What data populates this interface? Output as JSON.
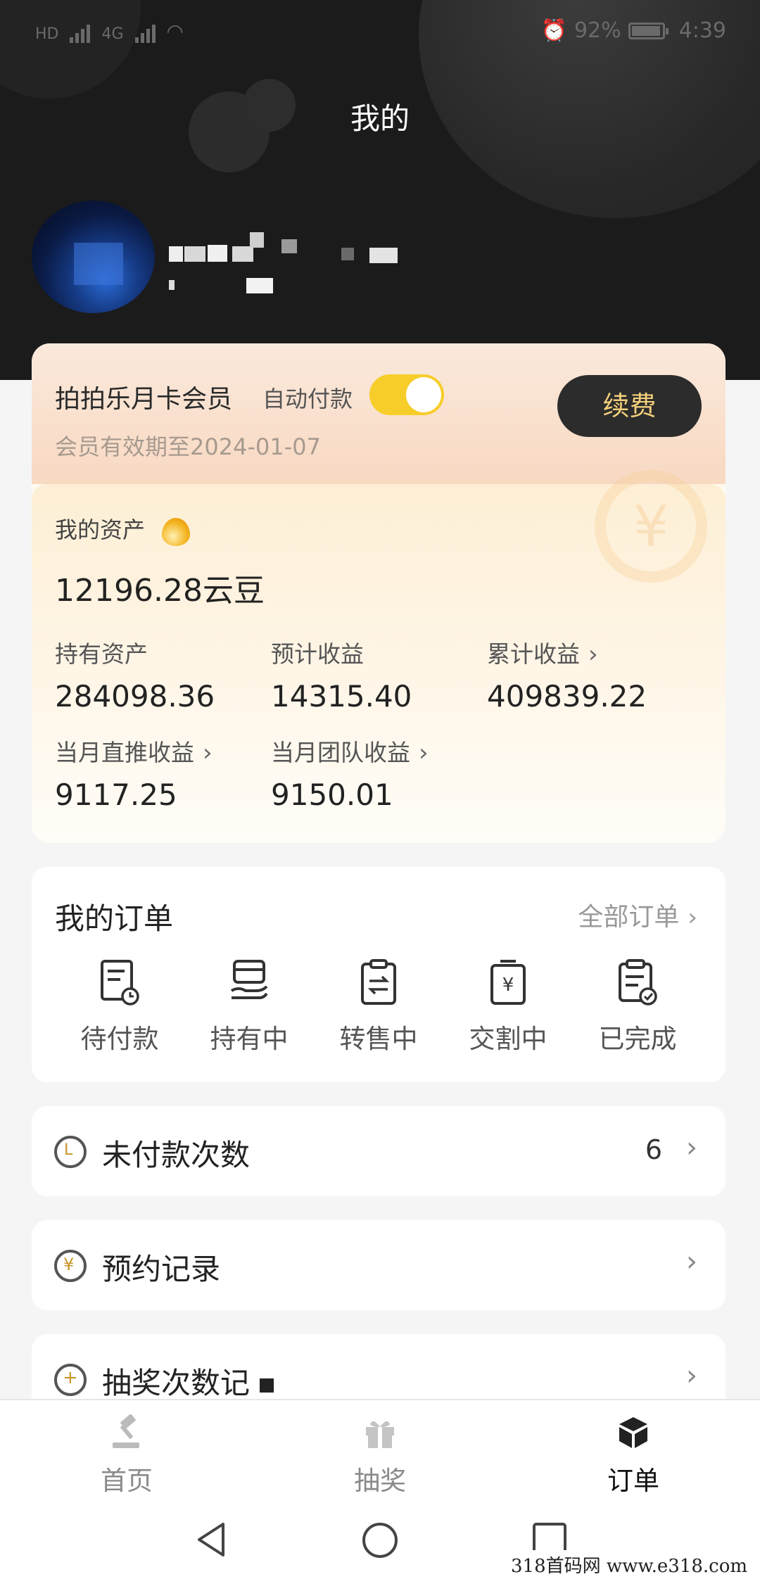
{
  "status_bar": {
    "battery": "92%",
    "time": "4:39",
    "network_left": "HD",
    "network_right": "4G"
  },
  "header": {
    "title": "我的"
  },
  "membership": {
    "name": "拍拍乐月卡会员",
    "auto_pay_label": "自动付款",
    "auto_pay_on": true,
    "expiry": "会员有效期至2024-01-07",
    "renew_label": "续费"
  },
  "assets": {
    "label": "我的资产",
    "total": "12196.28云豆",
    "stats": [
      {
        "label": "持有资产",
        "value": "284098.36",
        "has_arrow": false
      },
      {
        "label": "预计收益",
        "value": "14315.40",
        "has_arrow": false
      },
      {
        "label": "累计收益",
        "value": "409839.22",
        "has_arrow": true
      },
      {
        "label": "当月直推收益",
        "value": "9117.25",
        "has_arrow": true
      },
      {
        "label": "当月团队收益",
        "value": "9150.01",
        "has_arrow": true
      }
    ]
  },
  "orders": {
    "title": "我的订单",
    "all_label": "全部订单",
    "items": [
      {
        "label": "待付款",
        "icon": "pending-payment-icon"
      },
      {
        "label": "持有中",
        "icon": "holding-icon"
      },
      {
        "label": "转售中",
        "icon": "reselling-icon"
      },
      {
        "label": "交割中",
        "icon": "delivering-icon"
      },
      {
        "label": "已完成",
        "icon": "completed-icon"
      }
    ]
  },
  "rows": [
    {
      "label": "未付款次数",
      "count": "6",
      "icon": "clock-icon"
    },
    {
      "label": "预约记录",
      "count": "",
      "icon": "yuan-coin-icon"
    },
    {
      "label": "抽奖次数记",
      "count": "",
      "icon": "plus-coin-icon"
    }
  ],
  "bottom_nav": [
    {
      "label": "首页",
      "icon": "auction-hammer-icon",
      "active": false
    },
    {
      "label": "抽奖",
      "icon": "gift-box-icon",
      "active": false
    },
    {
      "label": "订单",
      "icon": "cube-icon",
      "active": true
    }
  ],
  "watermark": "318首码网  www.e318.com",
  "colors": {
    "header_bg": "#1b1b1b",
    "toggle_on": "#f7cd2a",
    "renew_bg": "#2c2c2c",
    "renew_text": "#f3cf7a"
  }
}
